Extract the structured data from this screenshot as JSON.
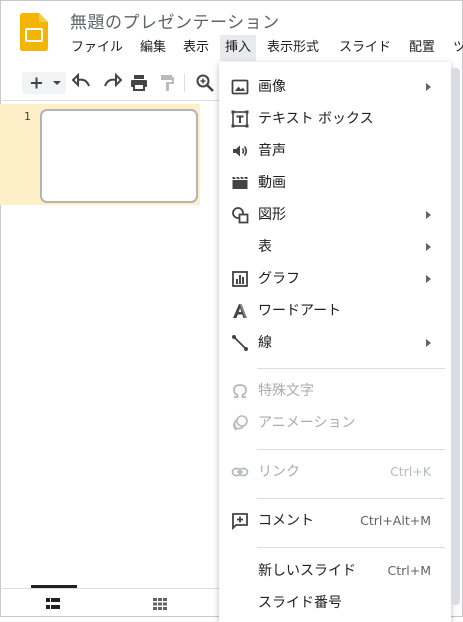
{
  "app": {
    "title": "無題のプレゼンテーション",
    "brand_color": "#f4b400"
  },
  "menubar": {
    "items": [
      {
        "label": "ファイル",
        "active": false
      },
      {
        "label": "編集",
        "active": false
      },
      {
        "label": "表示",
        "active": false
      },
      {
        "label": "挿入",
        "active": true
      },
      {
        "label": "表示形式",
        "active": false
      },
      {
        "label": "スライド",
        "active": false
      },
      {
        "label": "配置",
        "active": false
      },
      {
        "label": "ツ",
        "active": false
      }
    ]
  },
  "toolbar": {
    "new_slide_icon": "plus-icon",
    "dropdown_icon": "triangle-down-icon",
    "undo_icon": "undo-icon",
    "redo_icon": "redo-icon",
    "print_icon": "print-icon",
    "paint_format_icon": "paint-format-icon",
    "zoom_icon": "zoom-icon"
  },
  "filmstrip": {
    "slides": [
      {
        "number": "1"
      }
    ],
    "selected_bg": "#fdefc7"
  },
  "insert_menu": {
    "items": [
      {
        "label": "画像",
        "icon": "image-icon",
        "submenu": true,
        "disabled": false
      },
      {
        "label": "テキスト ボックス",
        "icon": "text-box-icon",
        "submenu": false,
        "disabled": false
      },
      {
        "label": "音声",
        "icon": "audio-icon",
        "submenu": false,
        "disabled": false
      },
      {
        "label": "動画",
        "icon": "video-icon",
        "submenu": false,
        "disabled": false
      },
      {
        "label": "図形",
        "icon": "shape-icon",
        "submenu": true,
        "disabled": false
      },
      {
        "label": "表",
        "icon": "",
        "submenu": true,
        "disabled": false
      },
      {
        "label": "グラフ",
        "icon": "chart-icon",
        "submenu": true,
        "disabled": false
      },
      {
        "label": "ワードアート",
        "icon": "word-art-icon",
        "submenu": false,
        "disabled": false
      },
      {
        "label": "線",
        "icon": "line-icon",
        "submenu": true,
        "disabled": false
      },
      {
        "label": "特殊文字",
        "icon": "omega-icon",
        "submenu": false,
        "disabled": true
      },
      {
        "label": "アニメーション",
        "icon": "animation-icon",
        "submenu": false,
        "disabled": true
      },
      {
        "label": "リンク",
        "icon": "link-icon",
        "submenu": false,
        "disabled": true,
        "shortcut": "Ctrl+K"
      },
      {
        "label": "コメント",
        "icon": "comment-icon",
        "submenu": false,
        "disabled": false,
        "shortcut": "Ctrl+Alt+M"
      },
      {
        "label": "新しいスライド",
        "icon": "",
        "submenu": false,
        "disabled": false,
        "shortcut": "Ctrl+M"
      },
      {
        "label": "スライド番号",
        "icon": "",
        "submenu": false,
        "disabled": false
      }
    ]
  }
}
